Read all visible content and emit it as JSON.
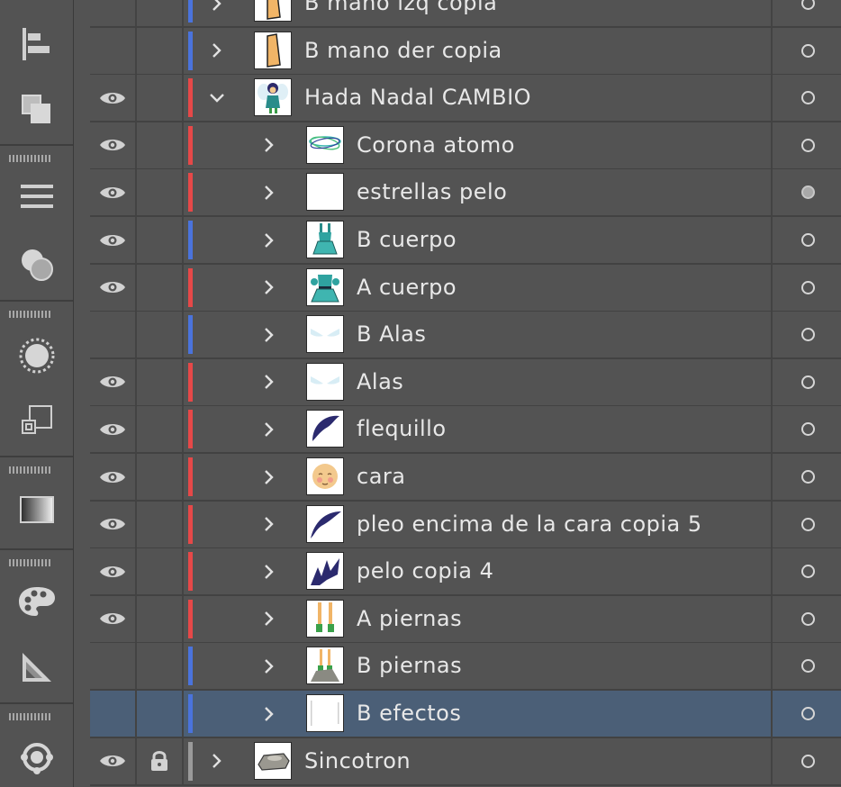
{
  "toolbar": {
    "tools": [
      {
        "name": "align-icon"
      },
      {
        "name": "pathfinder-icon"
      },
      {
        "name": "stroke-lines-icon"
      },
      {
        "name": "transparency-icon"
      },
      {
        "name": "appearance-icon"
      },
      {
        "name": "transform-icon"
      },
      {
        "name": "gradient-icon"
      },
      {
        "name": "color-palette-icon"
      },
      {
        "name": "color-guide-icon"
      },
      {
        "name": "sync-icon"
      }
    ]
  },
  "colors": {
    "red": "#e64848",
    "blue": "#4a73dc",
    "gray": "#9a9a9a",
    "selected_row": "#4b5f77"
  },
  "layers": [
    {
      "name": "B mano izq copia",
      "visible": false,
      "locked": false,
      "color": "blue",
      "indent": 1,
      "expanded": false,
      "thumb": "hand",
      "target": "empty"
    },
    {
      "name": "B mano der copia",
      "visible": false,
      "locked": false,
      "color": "blue",
      "indent": 1,
      "expanded": false,
      "thumb": "hand",
      "target": "empty"
    },
    {
      "name": "Hada Nadal CAMBIO",
      "visible": true,
      "locked": false,
      "color": "red",
      "indent": 1,
      "expanded": true,
      "thumb": "fairy",
      "target": "empty"
    },
    {
      "name": "Corona atomo",
      "visible": true,
      "locked": false,
      "color": "red",
      "indent": 2,
      "expanded": false,
      "thumb": "atom",
      "target": "empty"
    },
    {
      "name": "estrellas pelo",
      "visible": true,
      "locked": false,
      "color": "red",
      "indent": 2,
      "expanded": false,
      "thumb": "blank",
      "target": "filled"
    },
    {
      "name": "B cuerpo",
      "visible": true,
      "locked": false,
      "color": "blue",
      "indent": 2,
      "expanded": false,
      "thumb": "dress-b",
      "target": "empty"
    },
    {
      "name": "A cuerpo",
      "visible": true,
      "locked": false,
      "color": "red",
      "indent": 2,
      "expanded": false,
      "thumb": "dress-a",
      "target": "empty"
    },
    {
      "name": "B Alas",
      "visible": false,
      "locked": false,
      "color": "blue",
      "indent": 2,
      "expanded": false,
      "thumb": "wings",
      "target": "empty"
    },
    {
      "name": "Alas",
      "visible": true,
      "locked": false,
      "color": "red",
      "indent": 2,
      "expanded": false,
      "thumb": "wings",
      "target": "empty"
    },
    {
      "name": "flequillo",
      "visible": true,
      "locked": false,
      "color": "red",
      "indent": 2,
      "expanded": false,
      "thumb": "hair",
      "target": "empty"
    },
    {
      "name": "cara",
      "visible": true,
      "locked": false,
      "color": "red",
      "indent": 2,
      "expanded": false,
      "thumb": "face",
      "target": "empty"
    },
    {
      "name": "pleo encima de la cara copia 5",
      "visible": true,
      "locked": false,
      "color": "red",
      "indent": 2,
      "expanded": false,
      "thumb": "hair2",
      "target": "empty"
    },
    {
      "name": "pelo copia 4",
      "visible": true,
      "locked": false,
      "color": "red",
      "indent": 2,
      "expanded": false,
      "thumb": "hair3",
      "target": "empty"
    },
    {
      "name": "A piernas",
      "visible": true,
      "locked": false,
      "color": "red",
      "indent": 2,
      "expanded": false,
      "thumb": "legs",
      "target": "empty"
    },
    {
      "name": "B piernas",
      "visible": false,
      "locked": false,
      "color": "blue",
      "indent": 2,
      "expanded": false,
      "thumb": "legs-rock",
      "target": "empty"
    },
    {
      "name": "B efectos",
      "visible": false,
      "locked": false,
      "color": "blue",
      "indent": 2,
      "expanded": false,
      "thumb": "effects",
      "target": "empty",
      "selected": true
    },
    {
      "name": "Sincotron",
      "visible": true,
      "locked": true,
      "color": "gray",
      "indent": 1,
      "expanded": false,
      "thumb": "ship",
      "target": "empty"
    }
  ]
}
